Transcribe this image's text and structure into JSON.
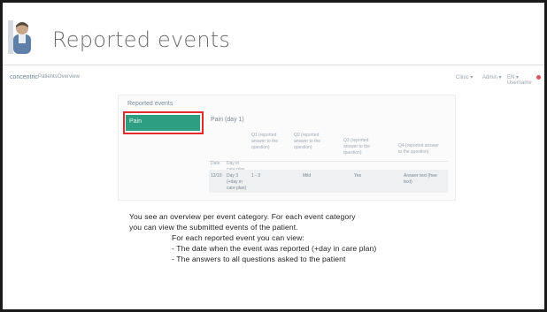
{
  "page": {
    "title": "Reported events"
  },
  "appbar": {
    "logo": "concentric",
    "nav": [
      "Patients",
      "Overview"
    ],
    "right": [
      "Clinic ▾",
      "Admin ▾",
      "EN ▾ Username"
    ]
  },
  "panel": {
    "heading": "Reported events",
    "category_label": "Pain",
    "category_detail": "Pain (day 1)",
    "columns": [
      "Date",
      "Day in care plan",
      "Q1 (reported answer to the question)",
      "Q2 (reported answer to the question)",
      "Q3 (reported answer to the question)",
      "Q4 (reported answer to the question)"
    ],
    "row": [
      "12/10",
      "Day 3 (+day in care plan)",
      "1 - 3",
      "Mild",
      "Yes",
      "Answer text (free text)"
    ]
  },
  "overlay": {
    "line1": "You see an overview per event category. For each event category",
    "line2": "you can view the submitted events of the patient.",
    "line3": "For each reported event you can view:",
    "line4": "- The date when the event was reported (+day in care plan)",
    "line5": "- The answers to all questions asked to the patient"
  },
  "colors": {
    "accent": "#2e9e83",
    "highlight": "#e22b2b",
    "title": "#6b6b6b"
  }
}
